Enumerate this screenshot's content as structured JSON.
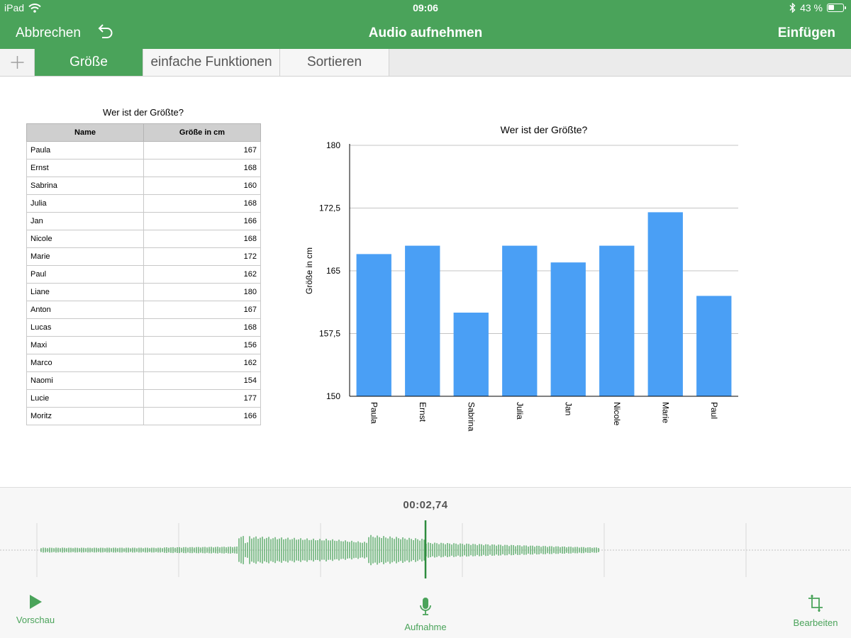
{
  "status_bar": {
    "device": "iPad",
    "time": "09:06",
    "battery": "43 %",
    "battery_level": 0.43
  },
  "nav": {
    "cancel": "Abbrechen",
    "title": "Audio aufnehmen",
    "insert": "Einfügen"
  },
  "tabs": [
    {
      "label": "Größe",
      "active": true
    },
    {
      "label": "einfache Funktionen",
      "active": false
    },
    {
      "label": "Sortieren",
      "active": false
    }
  ],
  "table": {
    "title": "Wer ist der Größte?",
    "headers": [
      "Name",
      "Größe in cm"
    ],
    "rows": [
      [
        "Paula",
        "167"
      ],
      [
        "Ernst",
        "168"
      ],
      [
        "Sabrina",
        "160"
      ],
      [
        "Julia",
        "168"
      ],
      [
        "Jan",
        "166"
      ],
      [
        "Nicole",
        "168"
      ],
      [
        "Marie",
        "172"
      ],
      [
        "Paul",
        "162"
      ],
      [
        "Liane",
        "180"
      ],
      [
        "Anton",
        "167"
      ],
      [
        "Lucas",
        "168"
      ],
      [
        "Maxi",
        "156"
      ],
      [
        "Marco",
        "162"
      ],
      [
        "Naomi",
        "154"
      ],
      [
        "Lucie",
        "177"
      ],
      [
        "Moritz",
        "166"
      ]
    ]
  },
  "chart_data": {
    "type": "bar",
    "title": "Wer ist der Größte?",
    "xlabel": "",
    "ylabel": "Größe in cm",
    "categories": [
      "Paula",
      "Ernst",
      "Sabrina",
      "Julia",
      "Jan",
      "Nicole",
      "Marie",
      "Paul"
    ],
    "values": [
      167,
      168,
      160,
      168,
      166,
      168,
      172,
      162
    ],
    "ylim": [
      150,
      180
    ],
    "yticks": [
      "150",
      "157,5",
      "165",
      "172,5",
      "180"
    ],
    "ytick_values": [
      150,
      157.5,
      165,
      172.5,
      180
    ],
    "grid": true,
    "bar_color": "#4a9ff5"
  },
  "recorder": {
    "time": "00:02,74",
    "preview": "Vorschau",
    "record": "Aufnahme",
    "edit": "Bearbeiten"
  },
  "colors": {
    "accent": "#4aa35a",
    "bar": "#4a9ff5"
  }
}
